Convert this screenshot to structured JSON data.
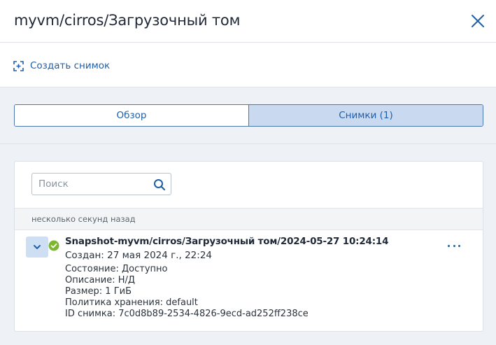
{
  "header": {
    "title": "myvm/cirros/Загрузочный том",
    "close_icon": "close-icon"
  },
  "toolbar": {
    "create_snapshot_label": "Создать снимок",
    "create_snapshot_icon": "snapshot-add-icon"
  },
  "tabs": [
    {
      "label": "Обзор",
      "active": false
    },
    {
      "label": "Снимки (1)",
      "active": true
    }
  ],
  "search": {
    "placeholder": "Поиск",
    "value": "",
    "icon": "search-icon"
  },
  "group": {
    "label": "несколько секунд назад"
  },
  "snapshot": {
    "name": "Snapshot-myvm/cirros/Загрузочный том/2024-05-27 10:24:14",
    "created": "Создан: 27 мая 2024 г., 22:24",
    "state": "Состояние: Доступно",
    "description": "Описание: Н/Д",
    "size": "Размер: 1 ГиБ",
    "retention": "Политика хранения: default",
    "id": "ID снимка: 7c0d8b89-2534-4826-9ecd-ad252ff238ce",
    "status_icon": "check-circle-icon",
    "expand_icon": "chevron-down-icon",
    "more_icon": "more-horizontal-icon"
  },
  "colors": {
    "accent": "#1e5fa8",
    "active_tab_bg": "#c9daf0",
    "success": "#7cb82f",
    "area_bg": "#eef2f6"
  }
}
